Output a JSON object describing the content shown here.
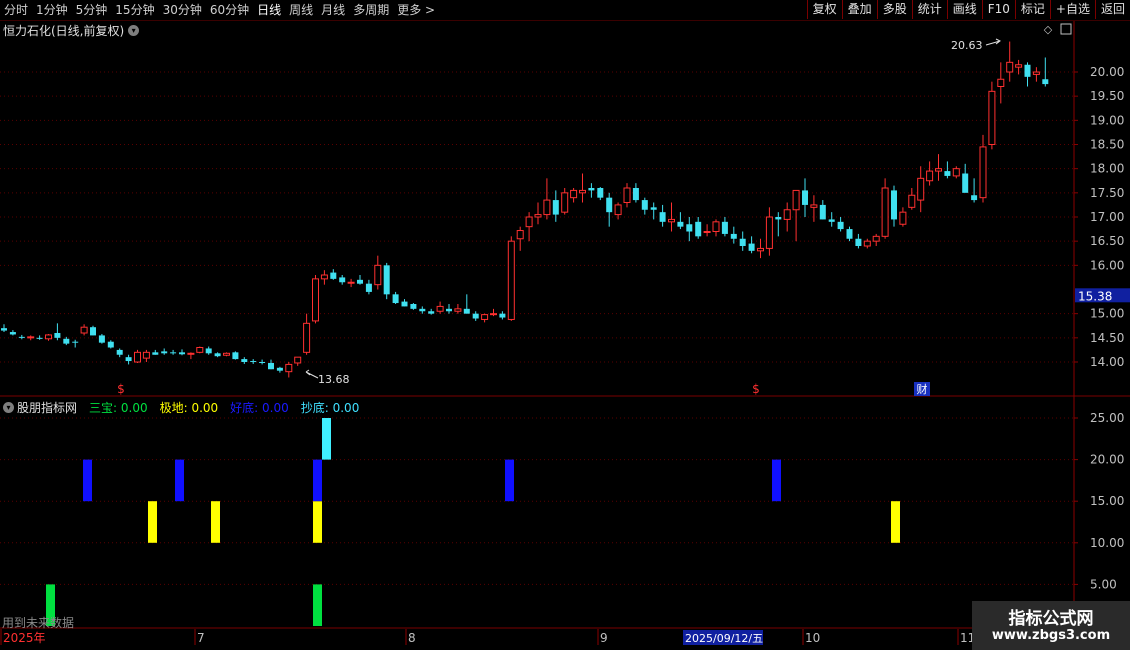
{
  "toolbar": {
    "periods": [
      "分时",
      "1分钟",
      "5分钟",
      "15分钟",
      "30分钟",
      "60分钟",
      "日线",
      "周线",
      "月线",
      "多周期",
      "更多 >"
    ],
    "active_period": "日线",
    "buttons": [
      "复权",
      "叠加",
      "多股",
      "统计",
      "画线",
      "F10",
      "标记",
      "+自选",
      "返回"
    ]
  },
  "main_chart": {
    "title": "恒力石化(日线,前复权)",
    "high_label": "20.63",
    "low_label": "13.68",
    "current_price": "15.38",
    "y_ticks": [
      "20.00",
      "19.50",
      "19.00",
      "18.50",
      "18.00",
      "17.50",
      "17.00",
      "16.50",
      "16.00",
      "15.00",
      "14.50",
      "14.00"
    ],
    "markers": [
      "$",
      "$",
      "财"
    ]
  },
  "indicator": {
    "name": "股朋指标网",
    "fields": [
      {
        "label": "三宝:",
        "value": "0.00",
        "color": "#00e040"
      },
      {
        "label": "极地:",
        "value": "0.00",
        "color": "#ffff00"
      },
      {
        "label": "好底:",
        "value": "0.00",
        "color": "#1a1aff"
      },
      {
        "label": "抄底:",
        "value": "0.00",
        "color": "#40e0ff"
      }
    ],
    "y_ticks": [
      "25.00",
      "20.00",
      "15.00",
      "10.00",
      "5.00"
    ],
    "note": "用到未来数据"
  },
  "x_axis": {
    "labels": [
      "2025年",
      "7",
      "8",
      "9",
      "10",
      "11"
    ],
    "cursor_date": "2025/09/12/五"
  },
  "watermark": {
    "title": "指标公式网",
    "url": "www.zbgs3.com"
  },
  "chart_data": {
    "type": "candlestick",
    "ohlc": [
      [
        14.7,
        14.78,
        14.62,
        14.65
      ],
      [
        14.62,
        14.66,
        14.55,
        14.57
      ],
      [
        14.52,
        14.56,
        14.47,
        14.5
      ],
      [
        14.5,
        14.55,
        14.45,
        14.52
      ],
      [
        14.5,
        14.55,
        14.46,
        14.48
      ],
      [
        14.48,
        14.58,
        14.44,
        14.56
      ],
      [
        14.6,
        14.8,
        14.45,
        14.5
      ],
      [
        14.48,
        14.52,
        14.35,
        14.38
      ],
      [
        14.42,
        14.46,
        14.3,
        14.4
      ],
      [
        14.6,
        14.78,
        14.55,
        14.72
      ],
      [
        14.72,
        14.75,
        14.55,
        14.55
      ],
      [
        14.55,
        14.58,
        14.38,
        14.4
      ],
      [
        14.42,
        14.45,
        14.28,
        14.3
      ],
      [
        14.25,
        14.28,
        14.1,
        14.15
      ],
      [
        14.1,
        14.15,
        13.95,
        14.02
      ],
      [
        14.0,
        14.25,
        13.98,
        14.2
      ],
      [
        14.08,
        14.25,
        14.0,
        14.2
      ],
      [
        14.2,
        14.25,
        14.15,
        14.15
      ],
      [
        14.22,
        14.28,
        14.15,
        14.18
      ],
      [
        14.2,
        14.25,
        14.15,
        14.18
      ],
      [
        14.2,
        14.26,
        14.14,
        14.16
      ],
      [
        14.16,
        14.2,
        14.06,
        14.18
      ],
      [
        14.2,
        14.32,
        14.18,
        14.3
      ],
      [
        14.28,
        14.32,
        14.15,
        14.18
      ],
      [
        14.18,
        14.2,
        14.1,
        14.12
      ],
      [
        14.14,
        14.2,
        14.12,
        14.18
      ],
      [
        14.2,
        14.22,
        14.05,
        14.06
      ],
      [
        14.06,
        14.1,
        13.96,
        14.0
      ],
      [
        14.02,
        14.06,
        13.96,
        14.0
      ],
      [
        14.0,
        14.05,
        13.95,
        13.98
      ],
      [
        13.98,
        14.05,
        13.85,
        13.85
      ],
      [
        13.88,
        13.9,
        13.78,
        13.82
      ],
      [
        13.8,
        14.0,
        13.68,
        13.95
      ],
      [
        13.98,
        14.1,
        13.92,
        14.1
      ],
      [
        14.2,
        15.0,
        14.15,
        14.8
      ],
      [
        14.85,
        15.8,
        14.8,
        15.72
      ],
      [
        15.72,
        15.9,
        15.6,
        15.8
      ],
      [
        15.85,
        15.92,
        15.7,
        15.72
      ],
      [
        15.75,
        15.8,
        15.6,
        15.65
      ],
      [
        15.65,
        15.72,
        15.55,
        15.65
      ],
      [
        15.7,
        15.8,
        15.6,
        15.62
      ],
      [
        15.62,
        15.7,
        15.4,
        15.45
      ],
      [
        15.6,
        16.2,
        15.5,
        16.0
      ],
      [
        16.0,
        16.05,
        15.3,
        15.4
      ],
      [
        15.4,
        15.45,
        15.2,
        15.22
      ],
      [
        15.25,
        15.3,
        15.15,
        15.15
      ],
      [
        15.2,
        15.22,
        15.08,
        15.1
      ],
      [
        15.1,
        15.15,
        15.0,
        15.05
      ],
      [
        15.05,
        15.1,
        14.98,
        15.0
      ],
      [
        15.05,
        15.25,
        15.0,
        15.15
      ],
      [
        15.1,
        15.2,
        15.0,
        15.05
      ],
      [
        15.05,
        15.2,
        15.0,
        15.1
      ],
      [
        15.1,
        15.4,
        15.0,
        15.0
      ],
      [
        15.0,
        15.05,
        14.85,
        14.9
      ],
      [
        14.88,
        15.0,
        14.82,
        14.98
      ],
      [
        15.0,
        15.1,
        14.95,
        15.0
      ],
      [
        15.0,
        15.05,
        14.88,
        14.92
      ],
      [
        14.88,
        16.6,
        14.85,
        16.5
      ],
      [
        16.55,
        16.8,
        16.3,
        16.72
      ],
      [
        16.8,
        17.1,
        16.5,
        17.0
      ],
      [
        17.0,
        17.3,
        16.85,
        17.05
      ],
      [
        17.05,
        17.8,
        16.95,
        17.35
      ],
      [
        17.35,
        17.55,
        16.9,
        17.05
      ],
      [
        17.1,
        17.6,
        17.05,
        17.5
      ],
      [
        17.4,
        17.6,
        17.3,
        17.55
      ],
      [
        17.5,
        17.9,
        17.3,
        17.55
      ],
      [
        17.6,
        17.7,
        17.4,
        17.55
      ],
      [
        17.6,
        17.62,
        17.35,
        17.4
      ],
      [
        17.4,
        17.5,
        16.8,
        17.1
      ],
      [
        17.05,
        17.3,
        16.95,
        17.25
      ],
      [
        17.3,
        17.7,
        17.2,
        17.6
      ],
      [
        17.6,
        17.7,
        17.3,
        17.35
      ],
      [
        17.35,
        17.4,
        17.05,
        17.15
      ],
      [
        17.2,
        17.3,
        16.95,
        17.15
      ],
      [
        17.1,
        17.25,
        16.8,
        16.9
      ],
      [
        16.9,
        17.3,
        16.7,
        16.95
      ],
      [
        16.9,
        17.1,
        16.75,
        16.8
      ],
      [
        16.85,
        17.0,
        16.5,
        16.7
      ],
      [
        16.9,
        17.0,
        16.55,
        16.6
      ],
      [
        16.7,
        16.85,
        16.6,
        16.7
      ],
      [
        16.7,
        16.95,
        16.6,
        16.9
      ],
      [
        16.9,
        17.0,
        16.6,
        16.65
      ],
      [
        16.65,
        16.8,
        16.45,
        16.55
      ],
      [
        16.55,
        16.7,
        16.3,
        16.4
      ],
      [
        16.45,
        16.6,
        16.25,
        16.3
      ],
      [
        16.3,
        16.55,
        16.15,
        16.35
      ],
      [
        16.35,
        17.2,
        16.2,
        17.0
      ],
      [
        17.0,
        17.1,
        16.6,
        16.95
      ],
      [
        16.95,
        17.3,
        16.7,
        17.15
      ],
      [
        17.15,
        17.5,
        16.5,
        17.55
      ],
      [
        17.55,
        17.8,
        17.0,
        17.25
      ],
      [
        17.2,
        17.45,
        16.9,
        17.25
      ],
      [
        17.25,
        17.35,
        16.95,
        16.95
      ],
      [
        16.95,
        17.1,
        16.8,
        16.9
      ],
      [
        16.9,
        17.0,
        16.7,
        16.75
      ],
      [
        16.75,
        16.8,
        16.5,
        16.55
      ],
      [
        16.55,
        16.65,
        16.35,
        16.4
      ],
      [
        16.4,
        16.55,
        16.35,
        16.5
      ],
      [
        16.5,
        16.65,
        16.4,
        16.6
      ],
      [
        16.6,
        17.8,
        16.55,
        17.6
      ],
      [
        17.55,
        17.65,
        16.8,
        16.95
      ],
      [
        16.85,
        17.2,
        16.8,
        17.1
      ],
      [
        17.2,
        17.6,
        17.15,
        17.45
      ],
      [
        17.35,
        18.05,
        17.1,
        17.8
      ],
      [
        17.75,
        18.15,
        17.65,
        17.95
      ],
      [
        17.95,
        18.3,
        17.75,
        18.0
      ],
      [
        17.95,
        18.15,
        17.8,
        17.85
      ],
      [
        17.85,
        18.05,
        17.8,
        18.0
      ],
      [
        17.9,
        18.1,
        17.55,
        17.5
      ],
      [
        17.45,
        17.8,
        17.3,
        17.35
      ],
      [
        17.4,
        18.7,
        17.3,
        18.45
      ],
      [
        18.5,
        19.8,
        18.4,
        19.6
      ],
      [
        19.7,
        20.2,
        19.35,
        19.85
      ],
      [
        20.0,
        20.63,
        19.8,
        20.2
      ],
      [
        20.1,
        20.25,
        19.95,
        20.15
      ],
      [
        20.15,
        20.2,
        19.7,
        19.9
      ],
      [
        19.95,
        20.1,
        19.8,
        20.0
      ],
      [
        19.85,
        20.3,
        19.7,
        19.75
      ]
    ],
    "indicator_bars": [
      {
        "idx": 3,
        "series": "三宝",
        "value": 5
      },
      {
        "idx": 10,
        "series": "好底",
        "value": 20
      },
      {
        "idx": 12,
        "series": "极地",
        "value": 15
      },
      {
        "idx": 14,
        "series": "好底",
        "value": 20
      },
      {
        "idx": 17,
        "series": "极地",
        "value": 15
      },
      {
        "idx": 26,
        "series": "三宝",
        "value": 5
      },
      {
        "idx": 26,
        "series": "极地",
        "value": 15
      },
      {
        "idx": 26,
        "series": "好底",
        "value": 20
      },
      {
        "idx": 27,
        "series": "抄底",
        "value": 25
      },
      {
        "idx": 42,
        "series": "好底",
        "value": 20
      },
      {
        "idx": 64,
        "series": "好底",
        "value": 20
      },
      {
        "idx": 74,
        "series": "极地",
        "value": 15
      }
    ],
    "ylim_main": [
      13.55,
      20.95
    ],
    "ylim_indicator": [
      0,
      27
    ]
  },
  "colors": {
    "up": "#ff3030",
    "down": "#40e0f0",
    "grid": "#5a0000",
    "axis": "#8b0000",
    "三宝": "#00e040",
    "极地": "#ffff00",
    "好底": "#1010ff",
    "抄底": "#40f0ff"
  }
}
